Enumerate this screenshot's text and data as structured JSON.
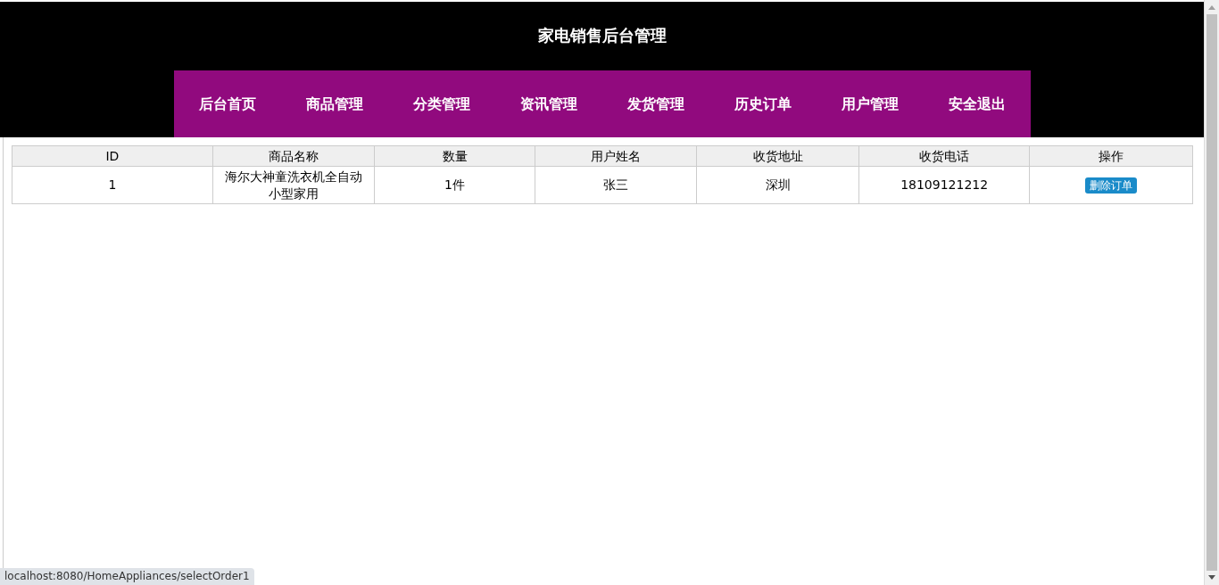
{
  "header": {
    "title": "家电销售后台管理"
  },
  "nav": [
    "后台首页",
    "商品管理",
    "分类管理",
    "资讯管理",
    "发货管理",
    "历史订单",
    "用户管理",
    "安全退出"
  ],
  "table": {
    "columns": [
      "ID",
      "商品名称",
      "数量",
      "用户姓名",
      "收货地址",
      "收货电话",
      "操作"
    ],
    "rows": [
      {
        "cells": [
          "1",
          "海尔大神童洗衣机全自动小型家用",
          "1件",
          "张三",
          "深圳",
          "18109121212"
        ],
        "action": "删除订单"
      }
    ]
  },
  "status_bar": "localhost:8080/HomeAppliances/selectOrder1"
}
